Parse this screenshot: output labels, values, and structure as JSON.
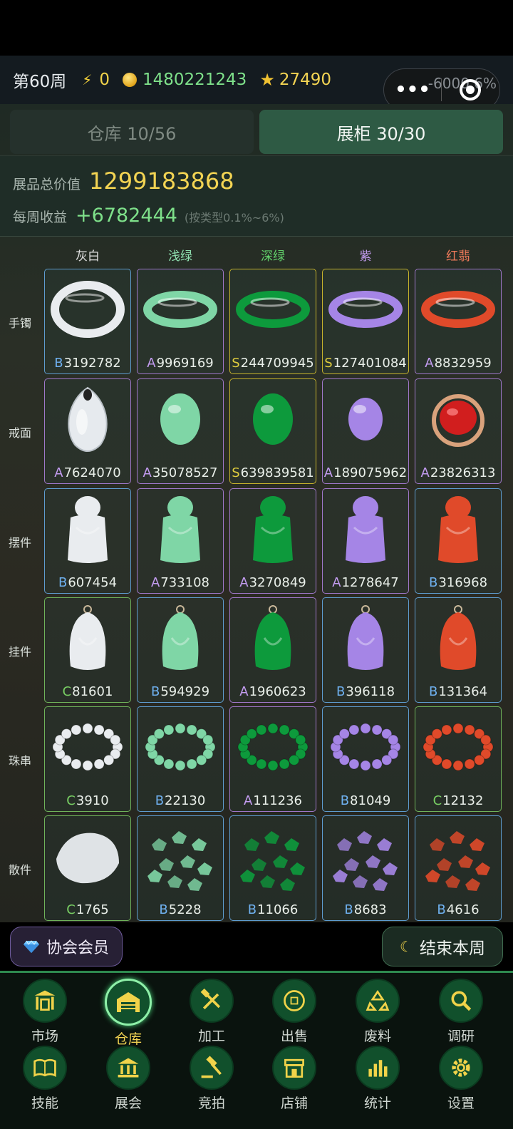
{
  "header": {
    "week": "第60周",
    "energy": "0",
    "coins": "1480221243",
    "stars": "27490",
    "overlay_text": "-6000 6%"
  },
  "tabs": [
    {
      "label": "仓库 10/56",
      "active": false
    },
    {
      "label": "展柜 30/30",
      "active": true
    }
  ],
  "summary": {
    "total_label": "展品总价值",
    "total_value": "1299183868",
    "income_label": "每周收益",
    "income_value": "+6782444",
    "income_note": "(按类型0.1%~6%)"
  },
  "columns": [
    {
      "label": "灰白",
      "color": "#e2e2e2"
    },
    {
      "label": "浅绿",
      "color": "#8fe0b0"
    },
    {
      "label": "深绿",
      "color": "#62d26b"
    },
    {
      "label": "紫",
      "color": "#c39cf0"
    },
    {
      "label": "红翡",
      "color": "#f07a5a"
    }
  ],
  "rows": [
    {
      "label": "手镯",
      "kind": "bangle",
      "cells": [
        {
          "grade": "B",
          "price": "3192782"
        },
        {
          "grade": "A",
          "price": "9969169"
        },
        {
          "grade": "S",
          "price": "244709945"
        },
        {
          "grade": "S",
          "price": "127401084"
        },
        {
          "grade": "A",
          "price": "8832959"
        }
      ]
    },
    {
      "label": "戒面",
      "kind": "cabochon",
      "cells": [
        {
          "grade": "A",
          "price": "7624070"
        },
        {
          "grade": "A",
          "price": "35078527"
        },
        {
          "grade": "S",
          "price": "639839581"
        },
        {
          "grade": "A",
          "price": "189075962"
        },
        {
          "grade": "A",
          "price": "23826313"
        }
      ]
    },
    {
      "label": "摆件",
      "kind": "carving",
      "cells": [
        {
          "grade": "B",
          "price": "607454"
        },
        {
          "grade": "A",
          "price": "733108"
        },
        {
          "grade": "A",
          "price": "3270849"
        },
        {
          "grade": "A",
          "price": "1278647"
        },
        {
          "grade": "B",
          "price": "316968"
        }
      ]
    },
    {
      "label": "挂件",
      "kind": "pendant",
      "cells": [
        {
          "grade": "C",
          "price": "81601"
        },
        {
          "grade": "B",
          "price": "594929"
        },
        {
          "grade": "A",
          "price": "1960623"
        },
        {
          "grade": "B",
          "price": "396118"
        },
        {
          "grade": "B",
          "price": "131364"
        }
      ]
    },
    {
      "label": "珠串",
      "kind": "beads",
      "cells": [
        {
          "grade": "C",
          "price": "3910"
        },
        {
          "grade": "B",
          "price": "22130"
        },
        {
          "grade": "A",
          "price": "111236"
        },
        {
          "grade": "B",
          "price": "81049"
        },
        {
          "grade": "C",
          "price": "12132"
        }
      ]
    },
    {
      "label": "散件",
      "kind": "rough",
      "cells": [
        {
          "grade": "C",
          "price": "1765"
        },
        {
          "grade": "B",
          "price": "5228"
        },
        {
          "grade": "B",
          "price": "11066"
        },
        {
          "grade": "B",
          "price": "8683"
        },
        {
          "grade": "B",
          "price": "4616"
        }
      ]
    }
  ],
  "jade_colors": [
    "#e9ecef",
    "#7fd6a6",
    "#0d9a3c",
    "#a585e6",
    "#e04a2a"
  ],
  "buttons": {
    "member": "协会会员",
    "end_week": "结束本周"
  },
  "nav": [
    {
      "label": "市场",
      "icon": "market-gate-icon",
      "selected": false
    },
    {
      "label": "仓库",
      "icon": "warehouse-icon",
      "selected": true
    },
    {
      "label": "加工",
      "icon": "hammer-wrench-icon",
      "selected": false
    },
    {
      "label": "出售",
      "icon": "coin-icon",
      "selected": false
    },
    {
      "label": "废料",
      "icon": "recycle-icon",
      "selected": false
    },
    {
      "label": "调研",
      "icon": "magnifier-icon",
      "selected": false
    },
    {
      "label": "技能",
      "icon": "book-icon",
      "selected": false
    },
    {
      "label": "展会",
      "icon": "museum-icon",
      "selected": false
    },
    {
      "label": "竞拍",
      "icon": "gavel-icon",
      "selected": false
    },
    {
      "label": "店铺",
      "icon": "shop-icon",
      "selected": false
    },
    {
      "label": "统计",
      "icon": "bar-chart-icon",
      "selected": false
    },
    {
      "label": "设置",
      "icon": "gear-icon",
      "selected": false
    }
  ]
}
